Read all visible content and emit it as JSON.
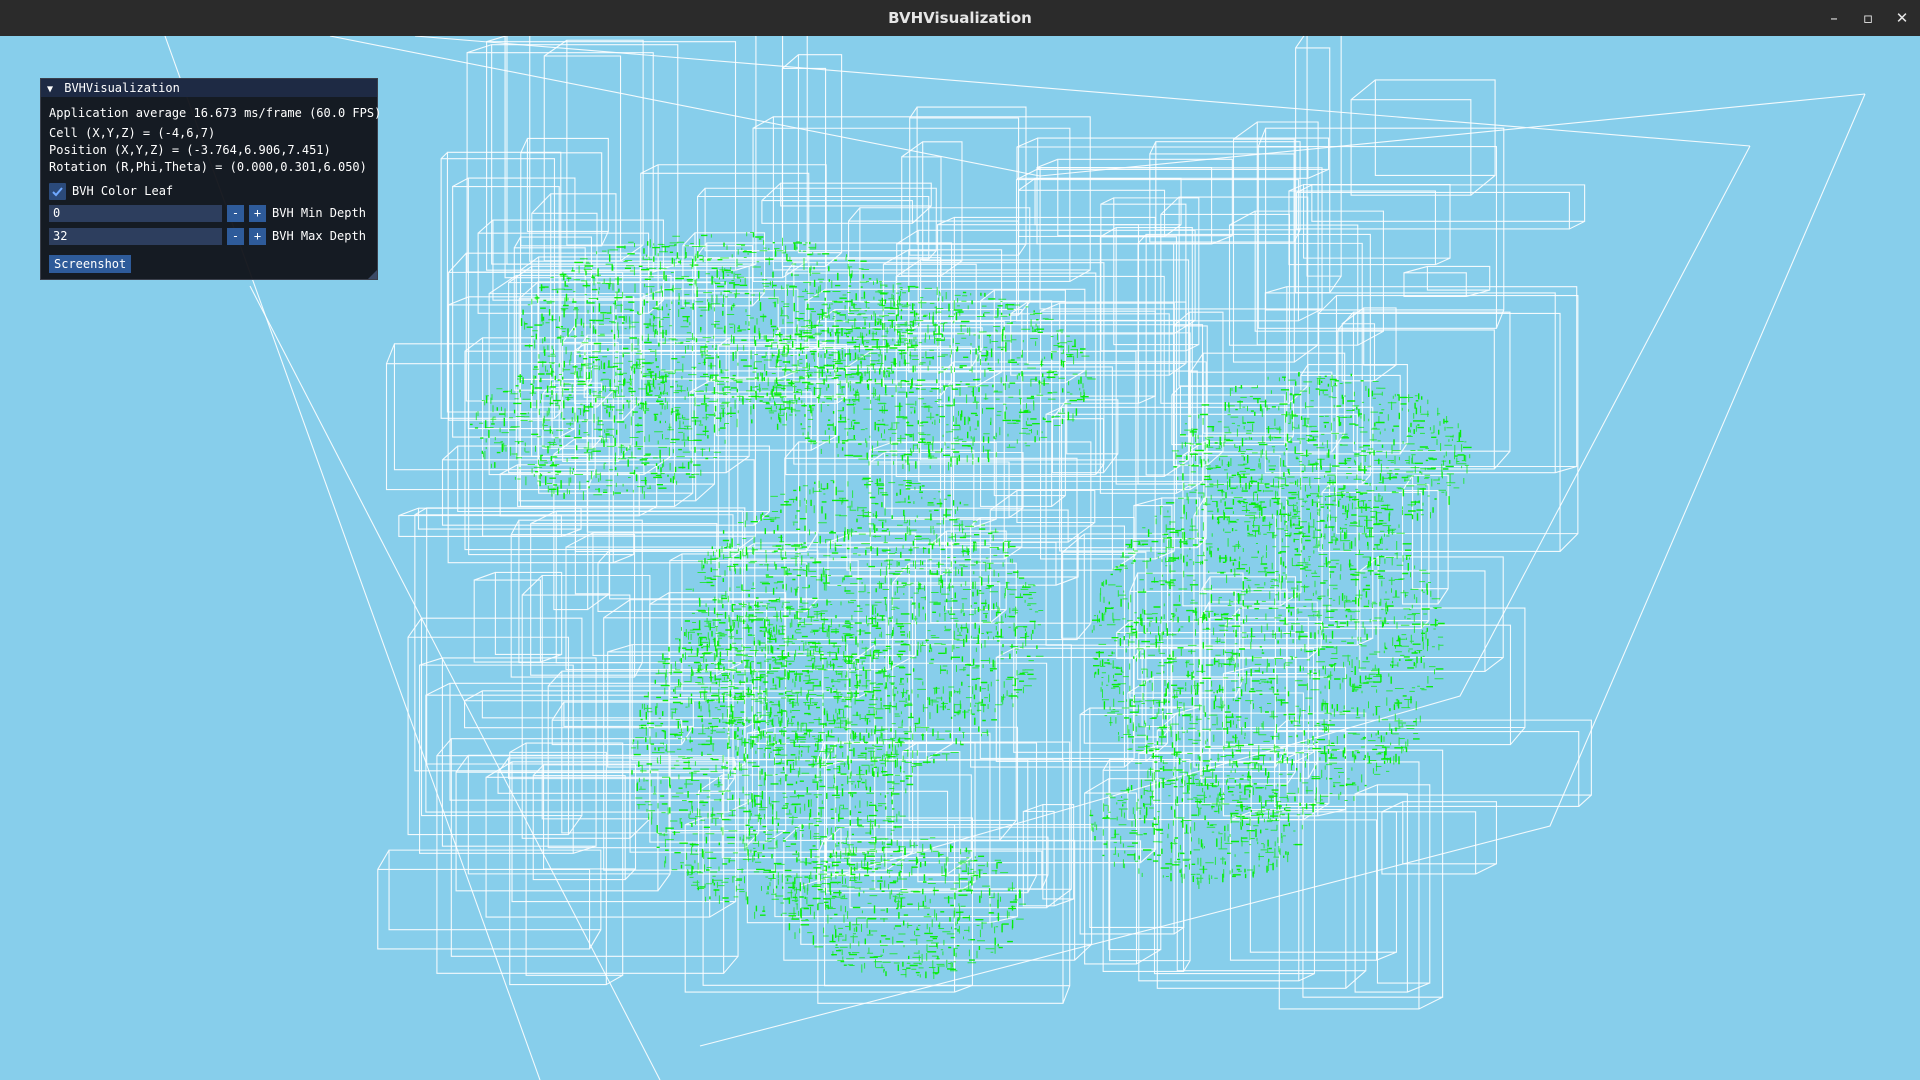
{
  "window": {
    "title": "BVHVisualization",
    "minimize_glyph": "–",
    "maximize_glyph": "▫",
    "close_glyph": "✕"
  },
  "scene": {
    "background_color": "#87ceeb",
    "box_color": "#ffffff",
    "leaf_color": "#00ee00"
  },
  "panel": {
    "title": "BVHVisualization",
    "collapse_glyph": "▼",
    "fps_text": "Application average 16.673 ms/frame (60.0 FPS)",
    "cell_text": "Cell (X,Y,Z) = (-4,6,7)",
    "position_text": "Position (X,Y,Z) = (-3.764,6.906,7.451)",
    "rotation_text": "Rotation (R,Phi,Theta) = (0.000,0.301,6.050)",
    "color_leaf": {
      "label": "BVH Color Leaf",
      "checked": true
    },
    "min_depth": {
      "value": "0",
      "label": "BVH Min Depth",
      "minus": "-",
      "plus": "+"
    },
    "max_depth": {
      "value": "32",
      "label": "BVH Max Depth",
      "minus": "-",
      "plus": "+"
    },
    "screenshot_label": "Screenshot"
  }
}
